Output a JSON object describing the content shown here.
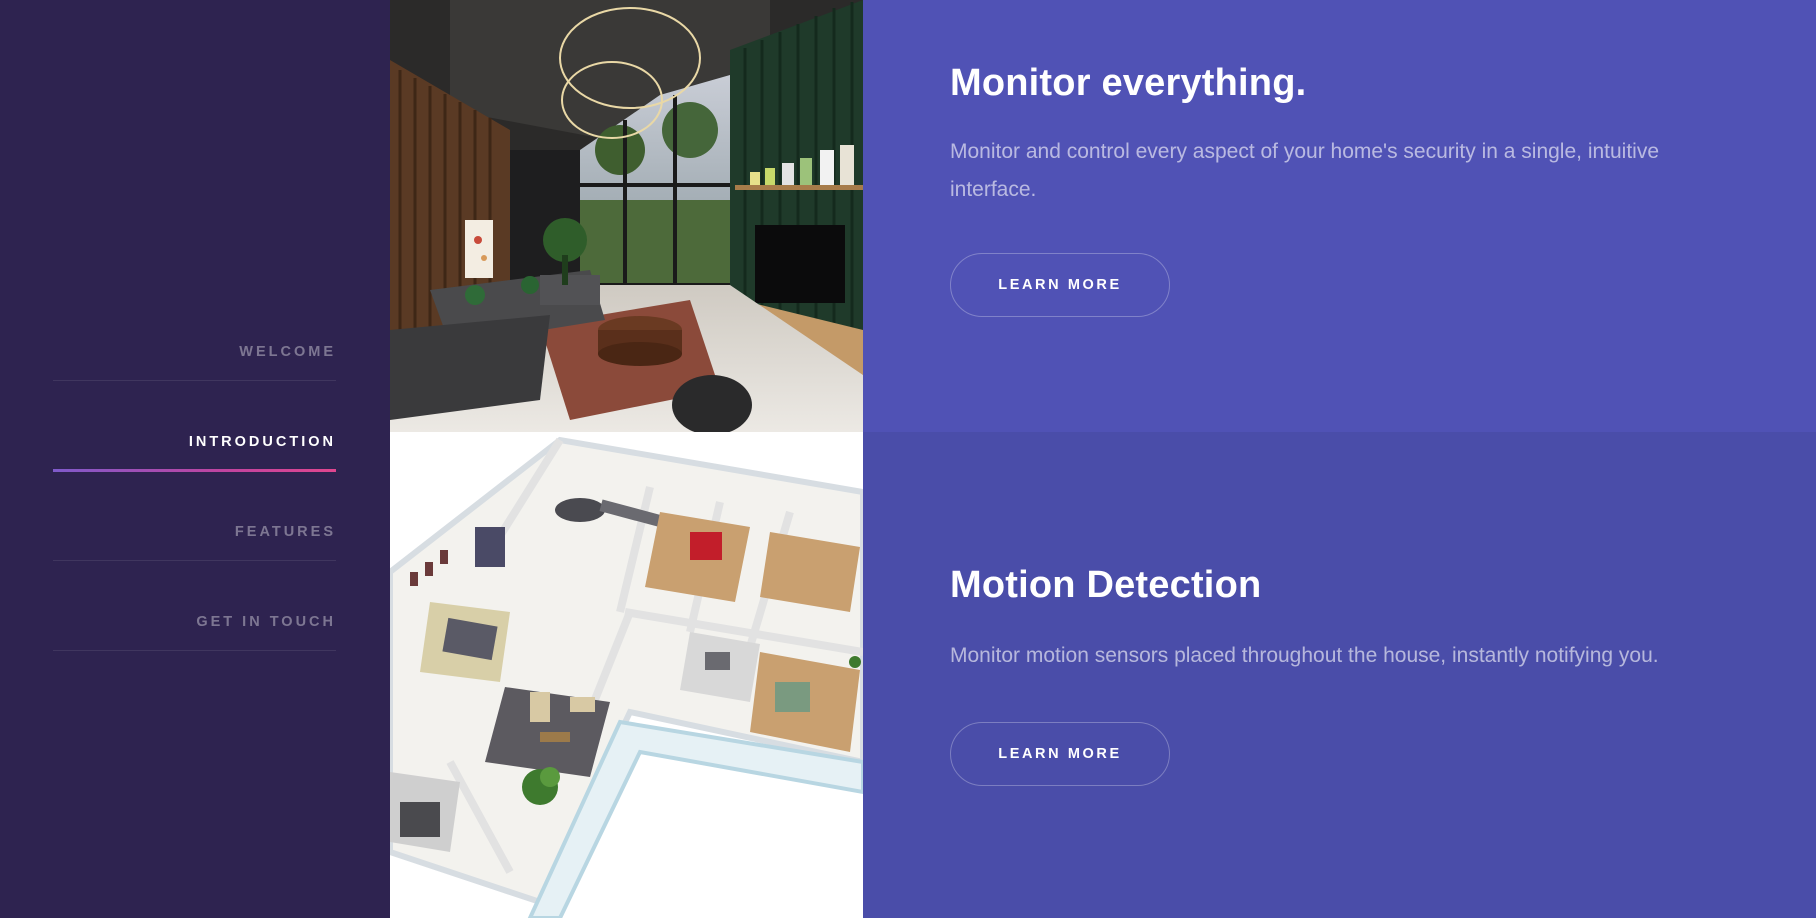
{
  "sidebar": {
    "nav": [
      {
        "label": "Welcome",
        "active": false
      },
      {
        "label": "Introduction",
        "active": true
      },
      {
        "label": "Features",
        "active": false
      },
      {
        "label": "Get in touch",
        "active": false
      }
    ]
  },
  "sections": [
    {
      "title": "Monitor everything.",
      "body": "Monitor and control every aspect of your home's security in a single, intuitive interface.",
      "button": "Learn more",
      "image": "living-room-photo"
    },
    {
      "title": "Motion Detection",
      "body": "Monitor motion sensors placed throughout the house, instantly notifying you.",
      "button": "Learn more",
      "image": "floor-plan-render"
    }
  ],
  "colors": {
    "sidebar_bg": "#2e2350",
    "section1_bg": "#5052b5",
    "section2_bg": "#4a4da9",
    "active_underline_start": "#7f5acb",
    "active_underline_end": "#e0468f"
  }
}
